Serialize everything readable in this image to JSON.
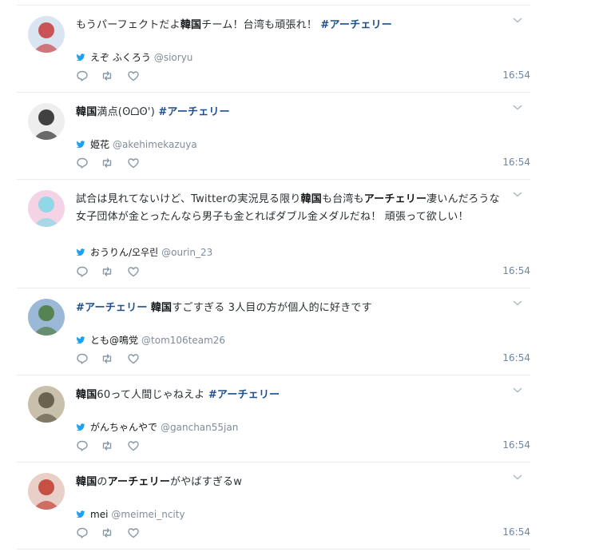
{
  "tweets": [
    {
      "segments": [
        {
          "t": "もうパーフェクトだよ",
          "s": "n"
        },
        {
          "t": "韓国",
          "s": "b"
        },
        {
          "t": "チーム！台湾も頑張れ！ ",
          "s": "n"
        },
        {
          "t": "#アーチェリー",
          "s": "h"
        }
      ],
      "author": "えぞ ふくろう",
      "handle": "@sioryu",
      "time": "16:54",
      "avatar_color": "#c73a3a"
    },
    {
      "segments": [
        {
          "t": "韓国",
          "s": "b"
        },
        {
          "t": "満点(ʘᗝʘ') ",
          "s": "n"
        },
        {
          "t": "#アーチェリー",
          "s": "h"
        }
      ],
      "author": "姫花",
      "handle": "@akehimekazuya",
      "time": "16:54",
      "avatar_color": "#222222"
    },
    {
      "segments": [
        {
          "t": "試合は見れてないけど、Twitterの実況見る限り",
          "s": "n"
        },
        {
          "t": "韓国",
          "s": "b"
        },
        {
          "t": "も台湾も",
          "s": "n"
        },
        {
          "t": "アーチェリー",
          "s": "b"
        },
        {
          "t": "凄いんだろうな 女子団体が金とったんなら男子も金とればダブル金メダルだね！ 頑張って欲しい！",
          "s": "n"
        }
      ],
      "author": "おうりん/오우린",
      "handle": "@ourin_23",
      "time": "16:54",
      "avatar_color": "#7fd8e6"
    },
    {
      "segments": [
        {
          "t": "#アーチェリー",
          "s": "h"
        },
        {
          "t": " ",
          "s": "n"
        },
        {
          "t": "韓国",
          "s": "b"
        },
        {
          "t": "すごすぎる 3人目の方が個人的に好きです",
          "s": "n"
        }
      ],
      "author": "とも@鳴党",
      "handle": "@tom106team26",
      "time": "16:54",
      "avatar_color": "#4a7a3a"
    },
    {
      "segments": [
        {
          "t": "韓国",
          "s": "b"
        },
        {
          "t": "60って人間じゃねえよ ",
          "s": "n"
        },
        {
          "t": "#アーチェリー",
          "s": "h"
        }
      ],
      "author": "がんちゃんやで",
      "handle": "@ganchan55jan",
      "time": "16:54",
      "avatar_color": "#5a5040"
    },
    {
      "segments": [
        {
          "t": "韓国",
          "s": "b"
        },
        {
          "t": "の",
          "s": "n"
        },
        {
          "t": "アーチェリー",
          "s": "b"
        },
        {
          "t": "がやばすぎるw",
          "s": "n"
        }
      ],
      "author": "mei",
      "handle": "@meimei_ncity",
      "time": "16:54",
      "avatar_color": "#c0392b"
    }
  ],
  "colors": {
    "link": "#1b4f8f",
    "twitter_blue": "#1da1f2",
    "meta_gray": "#7f8c99",
    "icon_gray": "#8899a6",
    "divider": "#e6ecf0"
  },
  "icons": {
    "bird": "twitter-bird-icon",
    "reply": "reply-icon",
    "retweet": "retweet-icon",
    "like": "heart-icon",
    "menu": "chevron-down-icon"
  }
}
